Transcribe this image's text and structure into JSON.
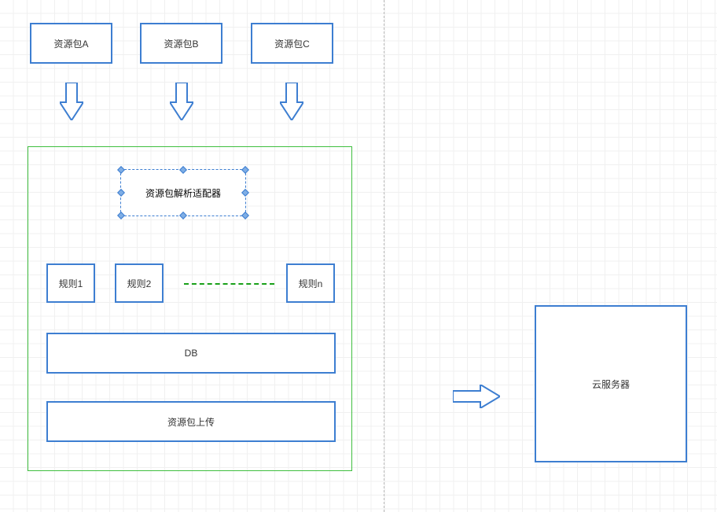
{
  "resources": {
    "a": "资源包A",
    "b": "资源包B",
    "c": "资源包C"
  },
  "adapter": "资源包解析适配器",
  "rules": {
    "r1": "规则1",
    "r2": "规则2",
    "rn": "规则n"
  },
  "db": "DB",
  "upload": "资源包上传",
  "cloud": "云服务器"
}
